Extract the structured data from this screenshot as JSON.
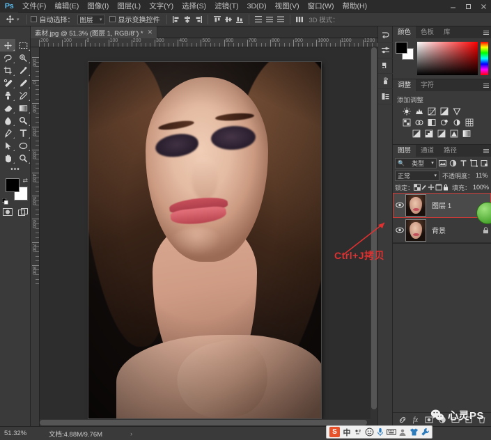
{
  "app": {
    "name": "Adobe Photoshop",
    "logo": "Ps"
  },
  "menubar": {
    "items": [
      {
        "label": "文件(F)",
        "name": "menu-file"
      },
      {
        "label": "编辑(E)",
        "name": "menu-edit"
      },
      {
        "label": "图像(I)",
        "name": "menu-image"
      },
      {
        "label": "图层(L)",
        "name": "menu-layer"
      },
      {
        "label": "文字(Y)",
        "name": "menu-type"
      },
      {
        "label": "选择(S)",
        "name": "menu-select"
      },
      {
        "label": "滤镜(T)",
        "name": "menu-filter"
      },
      {
        "label": "3D(D)",
        "name": "menu-3d"
      },
      {
        "label": "视图(V)",
        "name": "menu-view"
      },
      {
        "label": "窗口(W)",
        "name": "menu-window"
      },
      {
        "label": "帮助(H)",
        "name": "menu-help"
      }
    ],
    "window_controls": {
      "minimize": "—",
      "maximize": "❐",
      "close": "✕"
    }
  },
  "options_bar": {
    "active_tool": "move-tool",
    "auto_select_label": "自动选择：",
    "auto_select_value": "图层",
    "show_transform_label": "显示变换控件",
    "mode_3d_label": "3D 模式："
  },
  "document_tab": {
    "title": "素材.jpg @ 51.3% (图层 1, RGB/8\") *",
    "close": "✕"
  },
  "toolbox": {
    "tools": [
      {
        "name": "move-tool",
        "selected": true
      },
      {
        "name": "marquee-tool",
        "selected": false
      },
      {
        "name": "lasso-tool",
        "selected": false
      },
      {
        "name": "quick-select-tool",
        "selected": false
      },
      {
        "name": "crop-tool",
        "selected": false
      },
      {
        "name": "eyedropper-tool",
        "selected": false
      },
      {
        "name": "healing-brush-tool",
        "selected": false
      },
      {
        "name": "brush-tool",
        "selected": false
      },
      {
        "name": "clone-stamp-tool",
        "selected": false
      },
      {
        "name": "history-brush-tool",
        "selected": false
      },
      {
        "name": "eraser-tool",
        "selected": false
      },
      {
        "name": "gradient-tool",
        "selected": false
      },
      {
        "name": "blur-tool",
        "selected": false
      },
      {
        "name": "dodge-tool",
        "selected": false
      },
      {
        "name": "pen-tool",
        "selected": false
      },
      {
        "name": "type-tool",
        "selected": false
      },
      {
        "name": "path-select-tool",
        "selected": false
      },
      {
        "name": "ellipse-shape-tool",
        "selected": false
      },
      {
        "name": "hand-tool",
        "selected": false
      },
      {
        "name": "zoom-tool",
        "selected": false
      }
    ],
    "more_tools": "•••",
    "foreground_color": "#000000",
    "background_color": "#ffffff"
  },
  "rulers": {
    "horizontal_labels": [
      "200",
      "100",
      "0",
      "100",
      "200",
      "300",
      "400",
      "500",
      "600",
      "700",
      "800",
      "900",
      "1000",
      "1100",
      "1200"
    ],
    "vertical_labels": [
      "100",
      "0",
      "100",
      "200",
      "300",
      "400",
      "500",
      "600",
      "700",
      "800"
    ],
    "unit": "px"
  },
  "panels": {
    "color": {
      "tabs": [
        {
          "label": "颜色",
          "active": true,
          "name": "tab-color"
        },
        {
          "label": "色板",
          "active": false,
          "name": "tab-swatches"
        },
        {
          "label": "库",
          "active": false,
          "name": "tab-libraries"
        }
      ],
      "foreground": "#000000",
      "background": "#ffffff"
    },
    "adjustments": {
      "tabs": [
        {
          "label": "调整",
          "active": true,
          "name": "tab-adjustments"
        },
        {
          "label": "字符",
          "active": false,
          "name": "tab-character"
        }
      ],
      "heading": "添加调整",
      "row1": [
        "brightness-contrast-icon",
        "levels-icon",
        "curves-icon",
        "exposure-icon",
        "vibrance-icon"
      ],
      "row2": [
        "hue-saturation-icon",
        "color-balance-icon",
        "black-white-icon",
        "photo-filter-icon",
        "channel-mixer-icon",
        "color-lookup-icon"
      ],
      "row3": [
        "invert-icon",
        "posterize-icon",
        "threshold-icon",
        "selective-color-icon",
        "gradient-map-icon"
      ]
    },
    "layers": {
      "tabs": [
        {
          "label": "图层",
          "active": true,
          "name": "tab-layers"
        },
        {
          "label": "通道",
          "active": false,
          "name": "tab-channels"
        },
        {
          "label": "路径",
          "active": false,
          "name": "tab-paths"
        }
      ],
      "filter_kind": "类型",
      "filter_icons": [
        "filter-pixel-icon",
        "filter-adjustment-icon",
        "filter-type-icon",
        "filter-shape-icon",
        "filter-smart-icon"
      ],
      "blend_mode": "正常",
      "opacity_label": "不透明度：",
      "opacity_value": "11%",
      "lock_label": "锁定：",
      "lock_icons": [
        "lock-transparent-icon",
        "lock-image-icon",
        "lock-position-icon",
        "lock-artboard-icon",
        "lock-all-icon"
      ],
      "fill_label": "填充：",
      "fill_value": "100%",
      "items": [
        {
          "name": "图层 1",
          "selected": true,
          "visible": true,
          "locked": false
        },
        {
          "name": "背景",
          "selected": false,
          "visible": true,
          "locked": true
        }
      ],
      "bottom_icons": [
        "link-layers-icon",
        "layer-style-icon",
        "layer-mask-icon",
        "new-fill-adjustment-icon",
        "new-group-icon",
        "new-layer-icon",
        "delete-layer-icon"
      ]
    }
  },
  "dock_strip": {
    "icons": [
      "history-icon",
      "properties-icon",
      "paragraph-icon",
      "brushes-icon",
      "layer-comps-icon"
    ]
  },
  "annotation": {
    "text": "Ctrl+J拷贝",
    "color": "#e03030"
  },
  "status_bar": {
    "zoom": "51.32%",
    "doc_info": "文档:4.88M/9.76M",
    "expand": "›"
  },
  "ime_toolbar": {
    "logo": "S",
    "icons": [
      "chinese-mode-icon",
      "pinyin-icon",
      "emoji-icon",
      "voice-input-icon",
      "keyboard-icon",
      "user-icon",
      "skin-icon",
      "tools-icon"
    ],
    "mode_label": "中"
  },
  "watermark": {
    "text": "心灵PS",
    "icon": "wechat-icon"
  }
}
